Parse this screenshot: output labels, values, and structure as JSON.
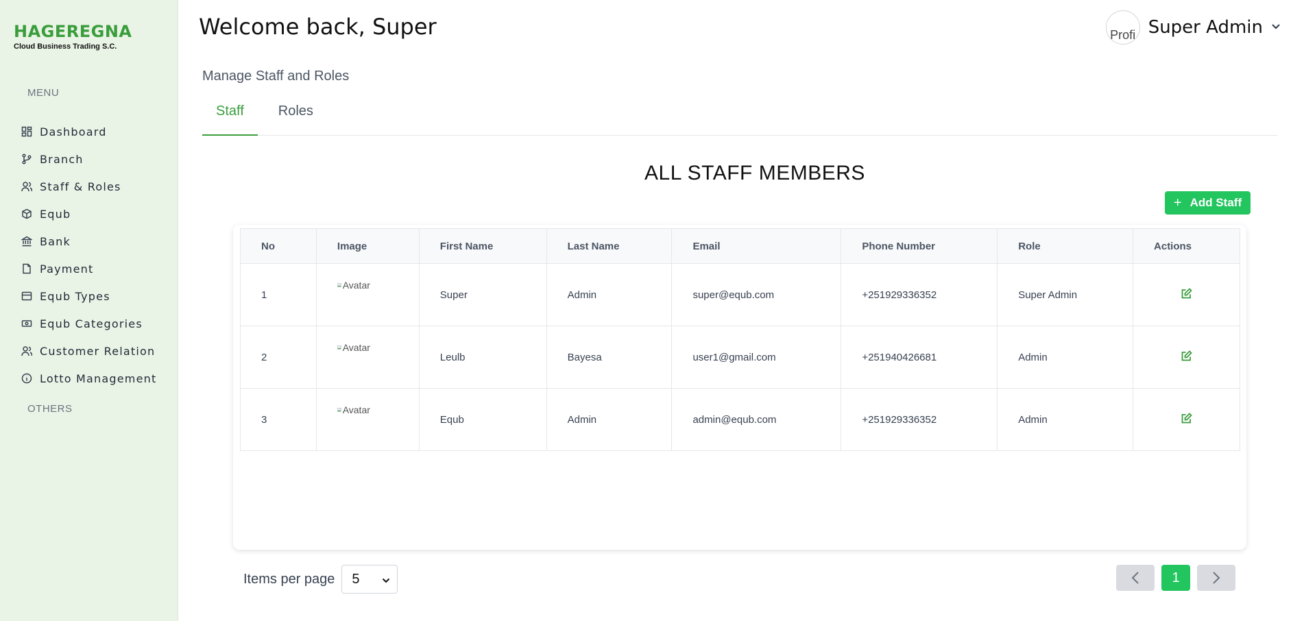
{
  "brand": {
    "name": "HAGEREGNA",
    "tagline": "Cloud  Business Trading S.C.",
    "color": "#3a9d3c"
  },
  "sidebar": {
    "menu_heading": "MENU",
    "others_heading": "OTHERS",
    "items": [
      {
        "label": "Dashboard",
        "icon": "dashboard-icon"
      },
      {
        "label": "Branch",
        "icon": "branch-icon"
      },
      {
        "label": "Staff & Roles",
        "icon": "users-icon"
      },
      {
        "label": "Equb",
        "icon": "box-icon"
      },
      {
        "label": "Bank",
        "icon": "bank-icon"
      },
      {
        "label": "Payment",
        "icon": "document-icon"
      },
      {
        "label": "Equb Types",
        "icon": "card-icon"
      },
      {
        "label": "Equb Categories",
        "icon": "money-icon"
      },
      {
        "label": "Customer Relation",
        "icon": "users-icon"
      },
      {
        "label": "Lotto Management",
        "icon": "info-icon"
      }
    ]
  },
  "header": {
    "welcome": "Welcome back, Super",
    "user_name": "Super Admin",
    "avatar_alt": "Profi"
  },
  "page": {
    "section_title": "Manage Staff and Roles",
    "tabs": [
      {
        "label": "Staff",
        "active": true
      },
      {
        "label": "Roles",
        "active": false
      }
    ],
    "card_title": "ALL STAFF MEMBERS",
    "add_button": "Add Staff"
  },
  "table": {
    "columns": [
      "No",
      "Image",
      "First Name",
      "Last Name",
      "Email",
      "Phone Number",
      "Role",
      "Actions"
    ],
    "rows": [
      {
        "no": "1",
        "image_alt": "Avatar",
        "first": "Super",
        "last": "Admin",
        "email": "super@equb.com",
        "phone": "+251929336352",
        "role": "Super Admin"
      },
      {
        "no": "2",
        "image_alt": "Avatar",
        "first": "Leulb",
        "last": "Bayesa",
        "email": "user1@gmail.com",
        "phone": "+251940426681",
        "role": "Admin"
      },
      {
        "no": "3",
        "image_alt": "Avatar",
        "first": "Equb",
        "last": "Admin",
        "email": "admin@equb.com",
        "phone": "+251929336352",
        "role": "Admin"
      }
    ]
  },
  "pagination": {
    "items_per_page_label": "Items per page",
    "items_per_page": "5",
    "current_page": "1"
  },
  "colors": {
    "accent": "#22c55e",
    "sidebar_bg": "#eaf4e6",
    "tab_active": "#3a9d3c"
  }
}
